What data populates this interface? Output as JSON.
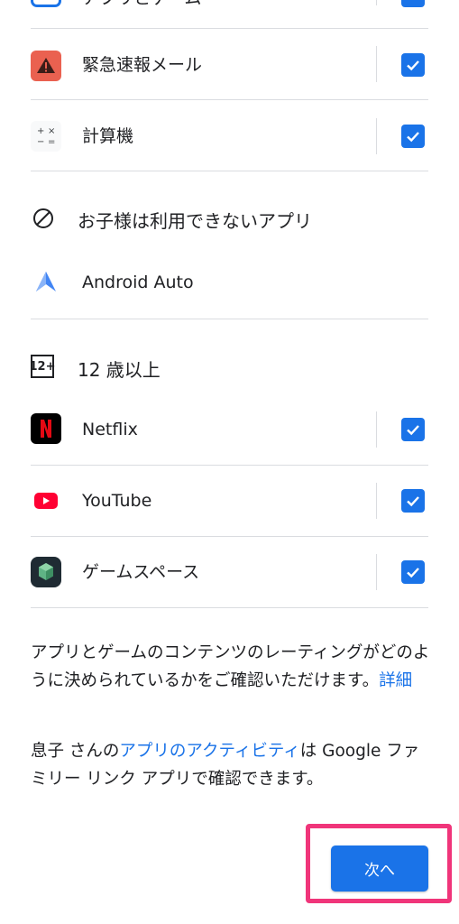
{
  "top_partial": {
    "label": "アプリとゲーム"
  },
  "apps_top": [
    {
      "label": "緊急速報メール",
      "checked": true,
      "icon": "warning-icon"
    },
    {
      "label": "計算機",
      "checked": true,
      "icon": "calculator-icon"
    }
  ],
  "unavailable": {
    "title": "お子様は利用できないアプリ",
    "icon": "block-icon",
    "apps": [
      {
        "label": "Android Auto",
        "icon": "android-auto-icon"
      }
    ]
  },
  "rating": {
    "badge": "12+",
    "title": "12 歳以上",
    "apps": [
      {
        "label": "Netflix",
        "checked": true,
        "icon": "netflix-icon"
      },
      {
        "label": "YouTube",
        "checked": true,
        "icon": "youtube-icon"
      },
      {
        "label": "ゲームスペース",
        "checked": true,
        "icon": "game-space-icon"
      }
    ]
  },
  "info": {
    "rating_text": "アプリとゲームのコンテンツのレーティングがどのように決められているかをご確認いただけます。",
    "rating_link": "詳細",
    "activity_prefix": "息子 さんの",
    "activity_link": "アプリのアクティビティ",
    "activity_suffix": "は Google ファミリー リンク アプリで確認できます。"
  },
  "footer": {
    "next_label": "次へ"
  },
  "colors": {
    "accent": "#1a73e8",
    "highlight": "#f0357a"
  }
}
